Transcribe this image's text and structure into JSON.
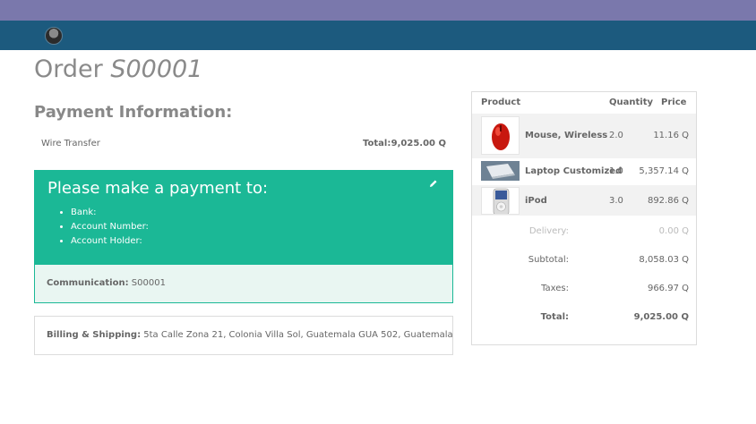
{
  "order": {
    "title_prefix": "Order",
    "number": "S00001"
  },
  "payment": {
    "heading": "Payment Information:",
    "method": "Wire Transfer",
    "total_label": "Total:",
    "total_value": "9,025.00 Q"
  },
  "instructions": {
    "heading": "Please make a payment to:",
    "items": [
      "Bank:",
      "Account Number:",
      "Account Holder:"
    ],
    "edit_icon": "pencil-icon"
  },
  "communication": {
    "label": "Communication:",
    "value": "S00001"
  },
  "billing": {
    "label": "Billing & Shipping:",
    "address": "5ta Calle Zona 21, Colonia Villa Sol, Guatemala GUA 502, Guatemala"
  },
  "summary": {
    "headers": {
      "product": "Product",
      "quantity": "Quantity",
      "price": "Price"
    },
    "lines": [
      {
        "name": "Mouse, Wireless",
        "qty": "2.0",
        "price": "11.16 Q",
        "image": "red-wireless-mouse"
      },
      {
        "name": "Laptop Customized",
        "qty": "1.0",
        "price": "5,357.14 Q",
        "image": "laptop"
      },
      {
        "name": "iPod",
        "qty": "3.0",
        "price": "892.86 Q",
        "image": "ipod"
      }
    ],
    "totals": {
      "delivery_label": "Delivery:",
      "delivery_value": "0.00 Q",
      "subtotal_label": "Subtotal:",
      "subtotal_value": "8,058.03 Q",
      "taxes_label": "Taxes:",
      "taxes_value": "966.97 Q",
      "total_label": "Total:",
      "total_value": "9,025.00 Q"
    }
  },
  "colors": {
    "topbar": "#7a78ac",
    "navbar": "#1c5a7e",
    "accent": "#1bb896",
    "accent_light": "#e9f6f2"
  }
}
